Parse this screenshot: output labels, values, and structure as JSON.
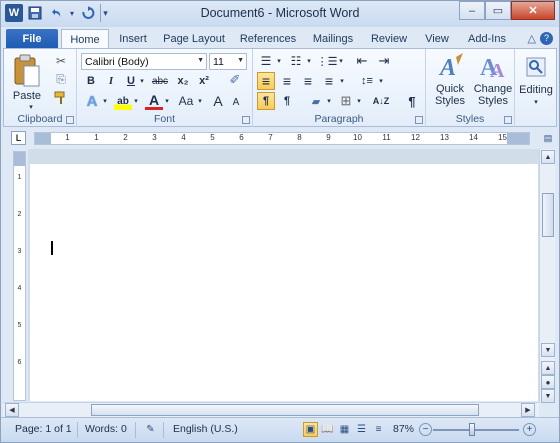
{
  "window": {
    "title": "Document6 - Microsoft Word",
    "logo_letter": "W",
    "controls": {
      "minimize": "–",
      "maximize": "▭",
      "close": "✕"
    }
  },
  "quick_access": {
    "save_icon": "💾",
    "undo_icon": "↶",
    "redo_icon": "↻",
    "customize_icon": "▾"
  },
  "tabs": [
    {
      "label": "File"
    },
    {
      "label": "Home"
    },
    {
      "label": "Insert"
    },
    {
      "label": "Page Layout"
    },
    {
      "label": "References"
    },
    {
      "label": "Mailings"
    },
    {
      "label": "Review"
    },
    {
      "label": "View"
    },
    {
      "label": "Add-Ins"
    }
  ],
  "tab_icons": {
    "minimize_ribbon": "△",
    "help": "?"
  },
  "ribbon": {
    "clipboard": {
      "label": "Clipboard",
      "paste": "Paste",
      "cut_icon": "✂",
      "copy_icon": "⎘",
      "format_painter_icon": "🖌"
    },
    "font": {
      "label": "Font",
      "font_name": "Calibri (Body)",
      "font_size": "11",
      "bold": "B",
      "italic": "I",
      "underline": "U",
      "strike": "abc",
      "subscript": "x₂",
      "superscript": "x²",
      "text_effects": "A",
      "highlight": "ab",
      "font_color": "A",
      "change_case": "Aa",
      "grow": "A",
      "shrink": "A",
      "clear": "✐"
    },
    "paragraph": {
      "label": "Paragraph",
      "bullets": "☰",
      "numbering": "☷",
      "multilevel": "⋮☰",
      "decrease_indent": "⇤",
      "increase_indent": "⇥",
      "align_left": "≡",
      "center": "≡",
      "align_right": "≡",
      "justify": "≡",
      "line_spacing": "↕≡",
      "ltr": "¶",
      "rtl": "¶",
      "shading": "▰",
      "borders": "⊞",
      "sort": "A↓Z",
      "show_marks": "¶"
    },
    "styles": {
      "label": "Styles",
      "quick_styles": "Quick\nStyles",
      "quick_styles_line1": "Quick",
      "quick_styles_line2": "Styles",
      "change_styles_line1": "Change",
      "change_styles_line2": "Styles"
    },
    "editing": {
      "label": "Editing"
    }
  },
  "ruler": {
    "tab_selector": "L",
    "h_numbers": [
      "1",
      "1",
      "2",
      "3",
      "4",
      "5",
      "6",
      "7",
      "8",
      "9",
      "10",
      "11",
      "12",
      "13",
      "14",
      "15"
    ],
    "v_numbers": [
      "1",
      "2",
      "3",
      "4",
      "5",
      "6"
    ]
  },
  "status": {
    "page": "Page: 1 of 1",
    "words": "Words: 0",
    "language": "English (U.S.)",
    "zoom": "87%",
    "zoom_out": "−",
    "zoom_in": "+"
  }
}
